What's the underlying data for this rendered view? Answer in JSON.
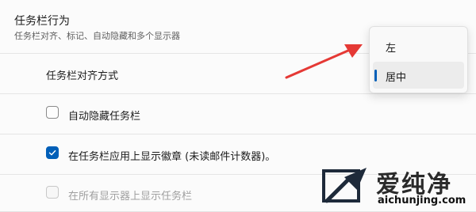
{
  "section": {
    "title": "任务栏行为",
    "subtitle": "任务栏对齐、标记、自动隐藏和多个显示器"
  },
  "alignment": {
    "label": "任务栏对齐方式",
    "options": [
      {
        "label": "左",
        "selected": false
      },
      {
        "label": "居中",
        "selected": true
      }
    ]
  },
  "checkboxes": [
    {
      "label": "自动隐藏任务栏",
      "checked": false,
      "disabled": false
    },
    {
      "label": "在任务栏应用上显示徽章 (未读邮件计数器)。",
      "checked": true,
      "disabled": false
    },
    {
      "label": "在所有显示器上显示任务栏",
      "checked": false,
      "disabled": true
    }
  ],
  "watermark": {
    "name": "爱纯净",
    "url": "aichunjing.com"
  },
  "colors": {
    "accent": "#005fb8",
    "annotation_arrow": "#e53935",
    "card_background": "#fbfbfb",
    "page_background": "#f3f3f3"
  }
}
